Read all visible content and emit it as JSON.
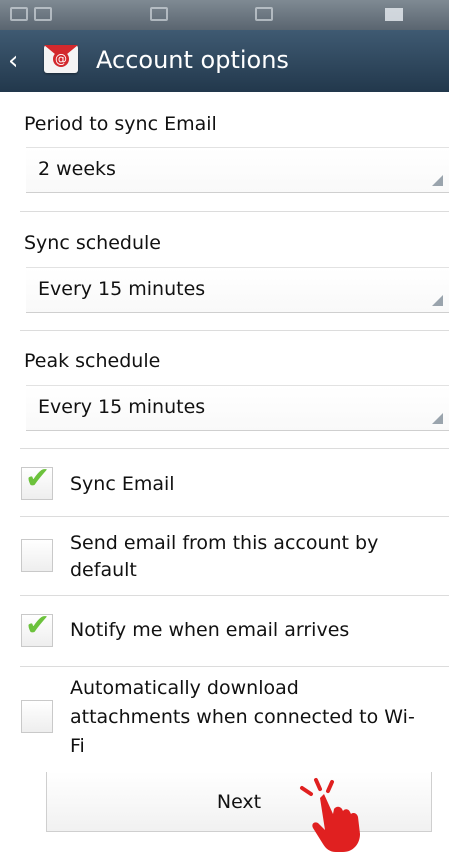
{
  "actionbar": {
    "title": "Account options"
  },
  "sync_period": {
    "label": "Period to sync Email",
    "value": "2 weeks"
  },
  "sync_schedule": {
    "label": "Sync schedule",
    "value": "Every 15 minutes"
  },
  "peak_schedule": {
    "label": "Peak schedule",
    "value": "Every 15 minutes"
  },
  "options": [
    {
      "label": "Sync Email",
      "checked": true
    },
    {
      "label_lines": [
        "Send email from this account by",
        "default"
      ],
      "checked": false
    },
    {
      "label": "Notify me when email arrives",
      "checked": true
    },
    {
      "label_lines": [
        "Automatically download",
        "attachments when connected to Wi-",
        "Fi"
      ],
      "checked": false
    }
  ],
  "next_button": {
    "label": "Next"
  },
  "colors": {
    "accent_check": "#6cc23c",
    "actionbar": "#2d4459",
    "icon_red": "#d3292d"
  }
}
